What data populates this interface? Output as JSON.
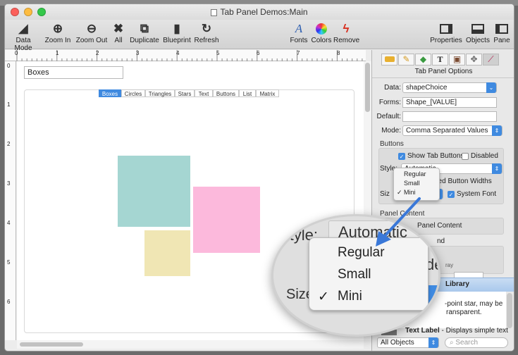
{
  "window": {
    "title": "Tab Panel Demos:Main"
  },
  "toolbar": {
    "items": [
      {
        "label": "Data Mode",
        "icon": "pen-nib-icon"
      },
      {
        "label": "Zoom In",
        "icon": "zoom-in-icon"
      },
      {
        "label": "Zoom Out",
        "icon": "zoom-out-icon"
      },
      {
        "label": "All",
        "icon": "fit-all-icon"
      },
      {
        "label": "Duplicate",
        "icon": "duplicate-icon"
      },
      {
        "label": "Blueprint",
        "icon": "blueprint-icon"
      },
      {
        "label": "Refresh",
        "icon": "refresh-icon"
      },
      {
        "label": "Fonts",
        "icon": "font-icon"
      },
      {
        "label": "Colors",
        "icon": "color-wheel-icon"
      },
      {
        "label": "Remove",
        "icon": "remove-icon"
      },
      {
        "label": "Properties",
        "icon": "properties-pane-icon"
      },
      {
        "label": "Objects",
        "icon": "objects-pane-icon"
      },
      {
        "label": "Pane",
        "icon": "pane-icon"
      }
    ],
    "glyphs": {
      "data_mode": "◢",
      "zoom_in": "⊕",
      "zoom_out": "⊖",
      "all": "✖",
      "duplicate": "⧉",
      "blueprint": "▮",
      "refresh": "↻",
      "fonts": "A",
      "remove": "ϟ"
    }
  },
  "ruler": {
    "marks": [
      "0",
      "1",
      "2",
      "3",
      "4",
      "5",
      "6",
      "7",
      "8"
    ],
    "vmarks": [
      "0",
      "1",
      "2",
      "3",
      "4",
      "5",
      "6"
    ]
  },
  "canvas": {
    "field_value": "Boxes",
    "tabs": [
      "Boxes",
      "Circles",
      "Triangles",
      "Stars",
      "Text",
      "Buttons",
      "List",
      "Matrix"
    ],
    "selected_tab": "Boxes",
    "box_colors": {
      "teal": "#a5d6d2",
      "pink": "#fcb9dc",
      "yellow": "#f0e6b4"
    }
  },
  "panel": {
    "title": "Tab Panel Options",
    "data_label": "Data:",
    "data_value": "shapeChoice",
    "forms_label": "Forms:",
    "forms_value": "Shape_[VALUE]",
    "default_label": "Default:",
    "default_value": "",
    "mode_label": "Mode:",
    "mode_value": "Comma Separated Values",
    "buttons_section": "Buttons",
    "show_tab_buttons": "Show Tab Buttons",
    "disabled": "Disabled",
    "style_label": "Style:",
    "style_value": "Automatic",
    "widths_text": "ded Button Widths",
    "size_label": "Siz",
    "system_font": "System Font",
    "panel_content_section": "Panel Content",
    "panel_content_value": "Panel Content",
    "nd_text": "nd",
    "gray_text": "ray",
    "library_title": "Library",
    "library_desc_line1": "-point star, may be",
    "library_desc_line2": "ransparent.",
    "text_label_title": "Text Label",
    "text_label_desc": " - Displays simple text",
    "filter_value": "All Objects",
    "search_placeholder": "Search"
  },
  "size_menu": {
    "options": [
      "Regular",
      "Small",
      "Mini"
    ],
    "checked": "Mini",
    "check_mark": "✓"
  },
  "magnifier": {
    "style_label": "Style:",
    "style_value": "Automatic",
    "size_label": "Size",
    "de_text": "de",
    "options": [
      "Regular",
      "Small",
      "Mini"
    ],
    "checked": "Mini",
    "check_mark": "✓"
  },
  "colors": {
    "accent": "#3f8ae0",
    "arrow": "#3a78d8"
  }
}
